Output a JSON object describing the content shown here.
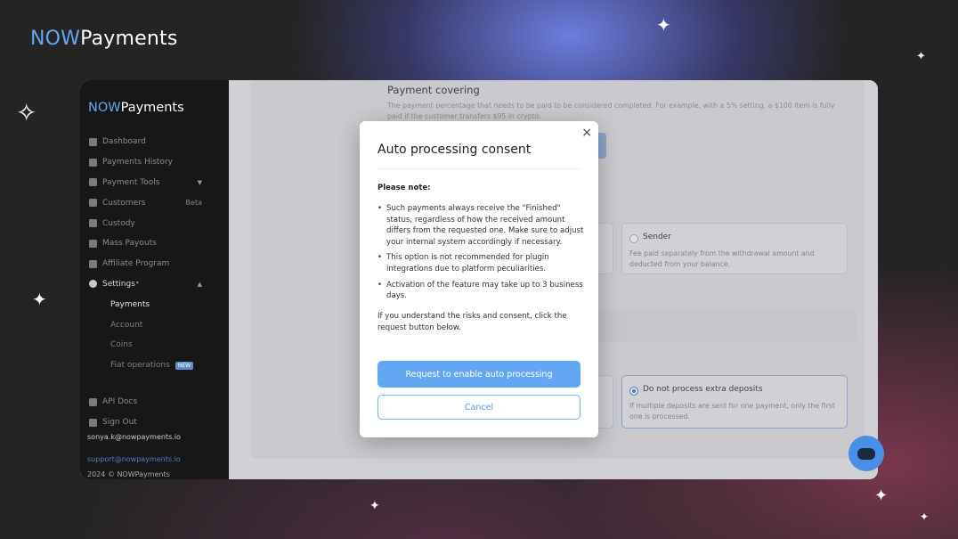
{
  "brand": {
    "now": "NOW",
    "payments": "Payments"
  },
  "sidebar": {
    "brand_now": "NOW",
    "brand_payments": "Payments",
    "items": [
      {
        "label": "Dashboard",
        "icon": "home-icon"
      },
      {
        "label": "Payments History",
        "icon": "history-icon"
      },
      {
        "label": "Payment Tools",
        "icon": "grid-icon",
        "caret": "▼"
      },
      {
        "label": "Customers",
        "icon": "users-icon",
        "extra": "Beta"
      },
      {
        "label": "Custody",
        "icon": "shield-icon"
      },
      {
        "label": "Mass Payouts",
        "icon": "person-icon"
      },
      {
        "label": "Affiliate Program",
        "icon": "person-icon"
      },
      {
        "label": "Settings",
        "icon": "gear-icon",
        "caret": "▲"
      }
    ],
    "settings_asterisk": "*",
    "sub_items": [
      "Payments",
      "Account",
      "Coins",
      "Fiat operations"
    ],
    "new_badge": "NEW",
    "bottom_items": [
      {
        "label": "API Docs",
        "icon": "docs-icon"
      },
      {
        "label": "Sign Out",
        "icon": "signout-icon"
      }
    ],
    "email": "sonya.k@nowpayments.io",
    "support": "support@nowpayments.io",
    "copyright": "2024 © NOWPayments"
  },
  "main": {
    "payment_covering_title": "Payment covering",
    "payment_covering_desc": "The payment percentage that needs to be paid to be considered completed. For example, with a 5% setting, a $100 item is fully paid if the customer transfers $95 in crypto.",
    "sender_title": "Sender",
    "sender_desc": "Fee paid separately from the withdrawal amount and deducted from your balance.",
    "no_extra_title": "Do not process extra deposits",
    "no_extra_desc": "If multiple deposits are sent for one payment, only the first one is processed."
  },
  "modal": {
    "title": "Auto processing consent",
    "close": "×",
    "note": "Please note:",
    "bullets": [
      "Such payments always receive the \"Finished\" status, regardless of how the received amount differs from the requested one. Make sure to adjust your internal system accordingly if necessary.",
      "This option is not recommended for plugin integrations due to platform peculiarities.",
      "Activation of the feature may take up to 3 business days."
    ],
    "consent": "If you understand the risks and consent, click the request button below.",
    "primary_button": "Request to enable auto processing",
    "cancel_button": "Cancel"
  },
  "colors": {
    "accent": "#62a6f4",
    "brand_now": "#64a7f0"
  }
}
